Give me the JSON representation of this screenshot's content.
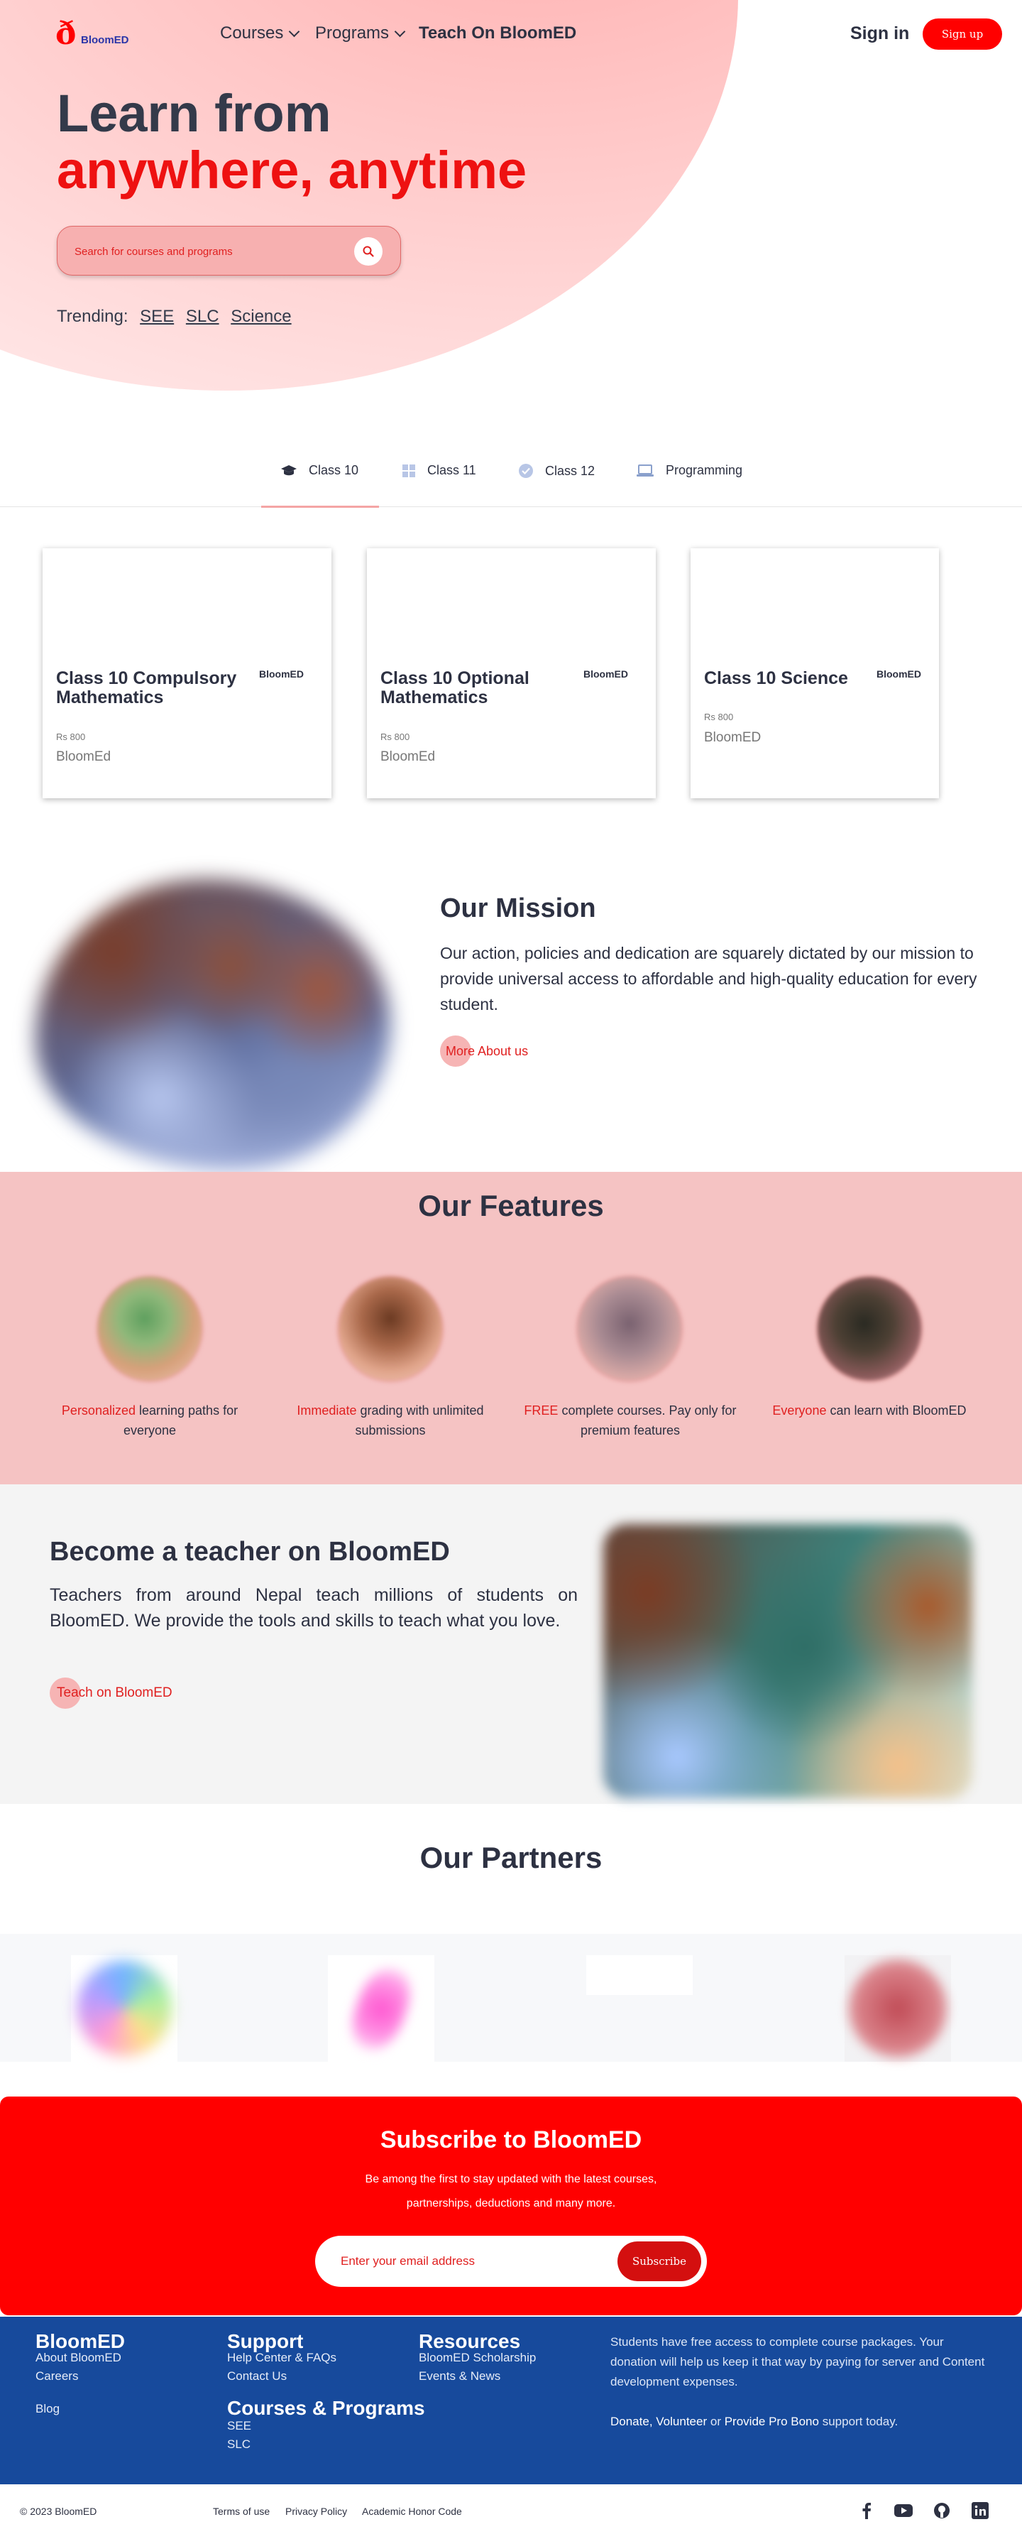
{
  "brand": {
    "name": "BloomED",
    "mark": "ð"
  },
  "nav": {
    "courses": "Courses",
    "programs": "Programs",
    "teach": "Teach On BloomED",
    "signin": "Sign in",
    "signup": "Sign up"
  },
  "hero": {
    "line1": "Learn from",
    "line2": "anywhere, anytime",
    "search_placeholder": "Search for courses and programs",
    "trending_label": "Trending:",
    "trending": [
      "SEE",
      "SLC",
      "Science"
    ]
  },
  "tabs": [
    {
      "label": "Class 10",
      "icon": "graduation-cap-icon"
    },
    {
      "label": "Class 11",
      "icon": "grid-icon"
    },
    {
      "label": "Class 12",
      "icon": "check-circle-icon"
    },
    {
      "label": "Programming",
      "icon": "laptop-icon"
    }
  ],
  "courses": [
    {
      "title": "Class 10 Compulsory Mathematics",
      "brand": "BloomED",
      "price": "Rs 800",
      "provider": "BloomEd"
    },
    {
      "title": "Class 10 Optional Mathematics",
      "brand": "BloomED",
      "price": "Rs 800",
      "provider": "BloomEd"
    },
    {
      "title": "Class 10 Science",
      "brand": "BloomED",
      "price": "Rs 800",
      "provider": "BloomED"
    }
  ],
  "mission": {
    "heading": "Our Mission",
    "text": "Our action, policies and dedication are squarely dictated by our mission to provide universal access to affordable and high-quality education for every student.",
    "button": "More About us"
  },
  "features": {
    "heading": "Our Features",
    "items": [
      {
        "highlight": "Personalized",
        "text": " learning paths for everyone"
      },
      {
        "highlight": "Immediate",
        "text": " grading with unlimited submissions"
      },
      {
        "highlight": "FREE",
        "text": " complete courses. Pay only for premium features"
      },
      {
        "highlight": "Everyone",
        "text": " can learn with BloomED"
      }
    ]
  },
  "teacher": {
    "heading": "Become a teacher on BloomED",
    "text": "Teachers from around Nepal teach millions of students on BloomED. We provide the tools and skills to teach what you love.",
    "button": "Teach on BloomED"
  },
  "partners": {
    "heading": "Our Partners"
  },
  "subscribe": {
    "heading": "Subscribe to BloomED",
    "text": "Be among the first to stay updated with the latest courses, partnerships, deductions and many more.",
    "placeholder": "Enter your email address",
    "button": "Subscribe"
  },
  "footer": {
    "col1": {
      "heading": "BloomED",
      "links": [
        "About BloomED",
        "Careers",
        "Blog"
      ]
    },
    "col2": {
      "heading": "Support",
      "links": [
        "Help Center & FAQs",
        "Contact Us"
      ]
    },
    "col3": {
      "heading": "Resources",
      "links": [
        "BloomED Scholarship",
        "Events & News"
      ]
    },
    "col4": {
      "heading": "Courses & Programs",
      "links": [
        "SEE",
        "SLC"
      ]
    },
    "note": "Students have free access to complete course packages. Your donation will help us keep it that way by paying for server and Content development expenses.",
    "donate": "Donate",
    "volunteer": "Volunteer",
    "or": "or",
    "probono": "Provide Pro Bono",
    "support": "support today."
  },
  "bottom": {
    "copyright": "© 2023 BloomED",
    "links": [
      "Terms of use",
      "Privacy Policy",
      "Academic Honor Code"
    ],
    "social": [
      "facebook-icon",
      "youtube-icon",
      "github-icon",
      "linkedin-icon"
    ]
  },
  "colors": {
    "accent": "#ff0000",
    "footer": "#174a9c",
    "features_bg": "#f5c3c3"
  }
}
